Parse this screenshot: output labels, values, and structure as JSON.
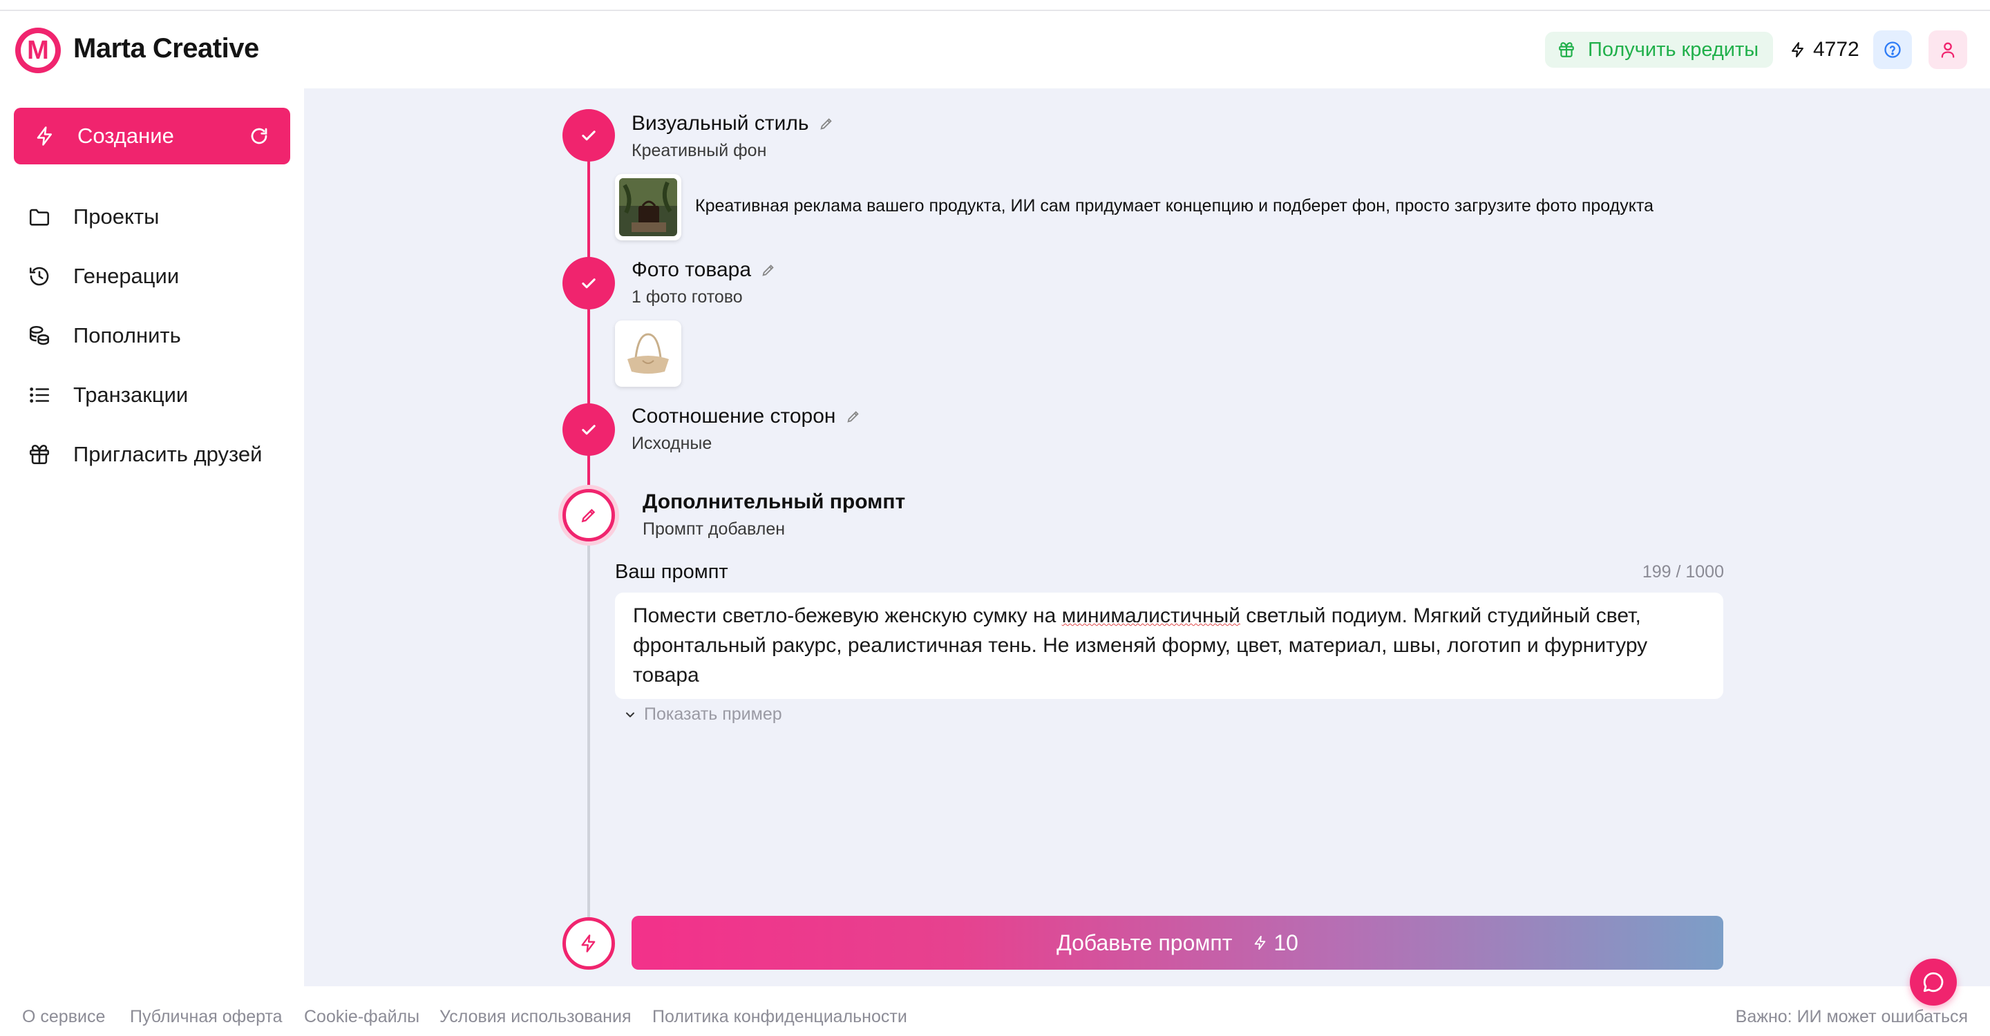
{
  "app": {
    "brand": "Marta Creative",
    "logo_letter": "M"
  },
  "header": {
    "get_credits_label": "Получить кредиты",
    "balance": "4772"
  },
  "sidebar": {
    "create_label": "Создание",
    "items": [
      {
        "label": "Проекты",
        "icon": "folder-icon"
      },
      {
        "label": "Генерации",
        "icon": "history-icon"
      },
      {
        "label": "Пополнить",
        "icon": "coins-icon"
      },
      {
        "label": "Транзакции",
        "icon": "list-icon"
      },
      {
        "label": "Пригласить друзей",
        "icon": "gift-icon"
      }
    ]
  },
  "steps": [
    {
      "title": "Визуальный стиль",
      "subtitle": "Креативный фон",
      "description": "Креативная реклама вашего продукта, ИИ сам придумает концепцию и подберет фон, просто загрузите фото продукта"
    },
    {
      "title": "Фото товара",
      "subtitle": "1 фото готово"
    },
    {
      "title": "Соотношение сторон",
      "subtitle": "Исходные"
    },
    {
      "title": "Дополнительный промпт",
      "subtitle": "Промпт добавлен"
    }
  ],
  "prompt": {
    "label": "Ваш промпт",
    "counter": "199 / 1000",
    "text_before": "Помести светло-бежевую женскую сумку на ",
    "text_flagged": "минималистичный",
    "text_after": " светлый подиум. Мягкий студийный свет, фронтальный ракурс, реалистичная тень. Не изменяй форму, цвет, материал, швы, логотип и фурнитуру товара",
    "show_example": "Показать пример"
  },
  "submit": {
    "label": "Добавьте промпт",
    "cost": "10"
  },
  "footer": {
    "links": [
      "О сервисе",
      "Публичная оферта",
      "Cookie-файлы",
      "Условия использования",
      "Политика конфиденциальности"
    ],
    "note": "Важно: ИИ может ошибаться"
  },
  "colors": {
    "accent": "#f0246e",
    "success": "#21b04b",
    "main_bg": "#eff1f9"
  }
}
